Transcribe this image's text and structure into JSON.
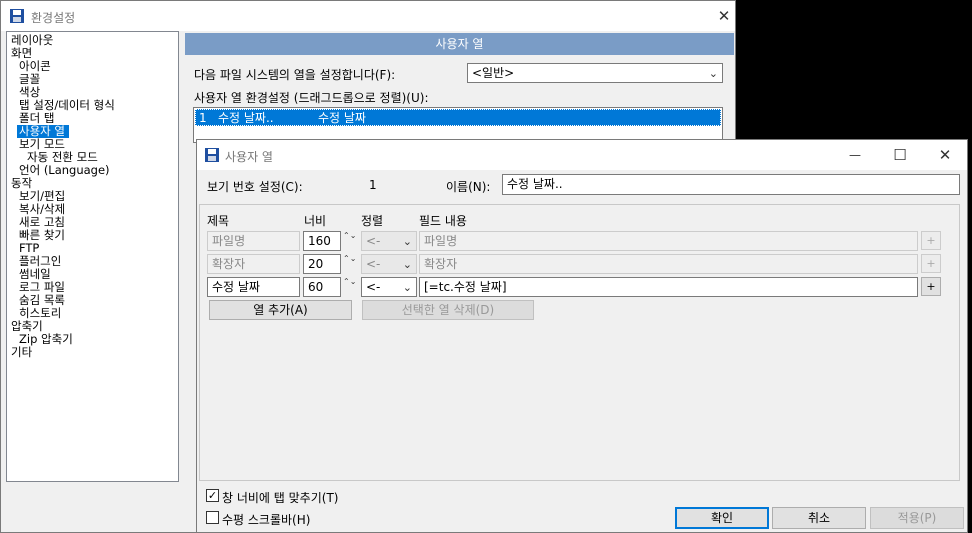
{
  "main_window": {
    "title": "환경설정",
    "close_glyph": "✕",
    "tree": [
      {
        "label": "레이아웃",
        "indent": 0
      },
      {
        "label": "화면",
        "indent": 0
      },
      {
        "label": "아이콘",
        "indent": 1
      },
      {
        "label": "글꼴",
        "indent": 1
      },
      {
        "label": "색상",
        "indent": 1
      },
      {
        "label": "탭 설정/데이터 형식",
        "indent": 1
      },
      {
        "label": "폴더 탭",
        "indent": 1
      },
      {
        "label": "사용자 열",
        "indent": 1,
        "selected": true
      },
      {
        "label": "보기 모드",
        "indent": 1
      },
      {
        "label": "자동 전환 모드",
        "indent": 2
      },
      {
        "label": "언어 (Language)",
        "indent": 1
      },
      {
        "label": "동작",
        "indent": 0
      },
      {
        "label": "보기/편집",
        "indent": 1
      },
      {
        "label": "복사/삭제",
        "indent": 1
      },
      {
        "label": "새로 고침",
        "indent": 1
      },
      {
        "label": "빠른 찾기",
        "indent": 1
      },
      {
        "label": "FTP",
        "indent": 1
      },
      {
        "label": "플러그인",
        "indent": 1
      },
      {
        "label": "썸네일",
        "indent": 1
      },
      {
        "label": "로그 파일",
        "indent": 1
      },
      {
        "label": "숨김 목록",
        "indent": 1
      },
      {
        "label": "히스토리",
        "indent": 1
      },
      {
        "label": "압축기",
        "indent": 0
      },
      {
        "label": "Zip 압축기",
        "indent": 1
      },
      {
        "label": "기타",
        "indent": 0
      }
    ],
    "section_header": "사용자 열",
    "filesystem_label": "다음 파일 시스템의 열을 설정합니다(F):",
    "filesystem_value": "<일반>",
    "column_settings_label": "사용자 열 환경설정 (드래그드롭으로 정렬)(U):",
    "column_list": [
      {
        "number": "1",
        "name": "수정 날짜..",
        "field": "수정 날짜"
      }
    ]
  },
  "dialog": {
    "title": "사용자 열",
    "minimize_glyph": "—",
    "maximize_glyph": "☐",
    "close_glyph": "✕",
    "view_number_label": "보기 번호 설정(C):",
    "view_number_value": "1",
    "name_label": "이름(N):",
    "name_value": "수정 날짜..",
    "headers": {
      "title": "제목",
      "width": "너비",
      "align": "정렬",
      "field": "필드 내용"
    },
    "rows": [
      {
        "title": "파일명",
        "width": "160",
        "align": "<-",
        "field": "파일명",
        "disabled": true
      },
      {
        "title": "확장자",
        "width": "20",
        "align": "<-",
        "field": "확장자",
        "disabled": true
      },
      {
        "title": "수정 날짜",
        "width": "60",
        "align": "<-",
        "field": "[=tc.수정 날짜]",
        "disabled": false
      }
    ],
    "plus_glyph": "+",
    "spin_glyph": "⌃⌄",
    "add_column_button": "열 추가(A)",
    "delete_column_button": "선택한 열 삭제(D)",
    "fit_tab_checkbox": {
      "label": "창 너비에 탭 맞추기(T)",
      "checked": true,
      "mark": "✓"
    },
    "hscroll_checkbox": {
      "label": "수평 스크롤바(H)",
      "checked": false
    },
    "ok_button": "확인",
    "cancel_button": "취소",
    "apply_button": "적용(P)"
  }
}
